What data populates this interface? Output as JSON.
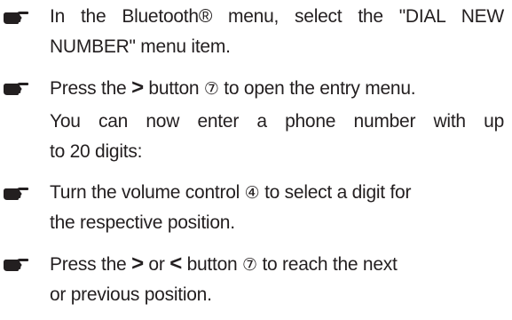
{
  "steps": [
    {
      "line1": "In the Bluetooth® menu, select the \"DIAL NEW",
      "line2": "NUMBER\" menu item."
    },
    {
      "pre": "Press the",
      "btn": ">",
      "mid": "button",
      "num": "⑦",
      "post": "to open the entry menu."
    },
    {
      "line1": "You can now enter a phone number with up",
      "line2": "to 20 digits:"
    },
    {
      "pre": "Turn the volume control",
      "num": "④",
      "post": "to select a digit for",
      "line2": "the respective position."
    },
    {
      "pre": "Press the",
      "btn1": ">",
      "or": "or",
      "btn2": "<",
      "mid": "button",
      "num": "⑦",
      "post": "to reach the next",
      "line2": "or previous position."
    }
  ],
  "icons": {
    "bullet": "pointing-hand-icon"
  }
}
